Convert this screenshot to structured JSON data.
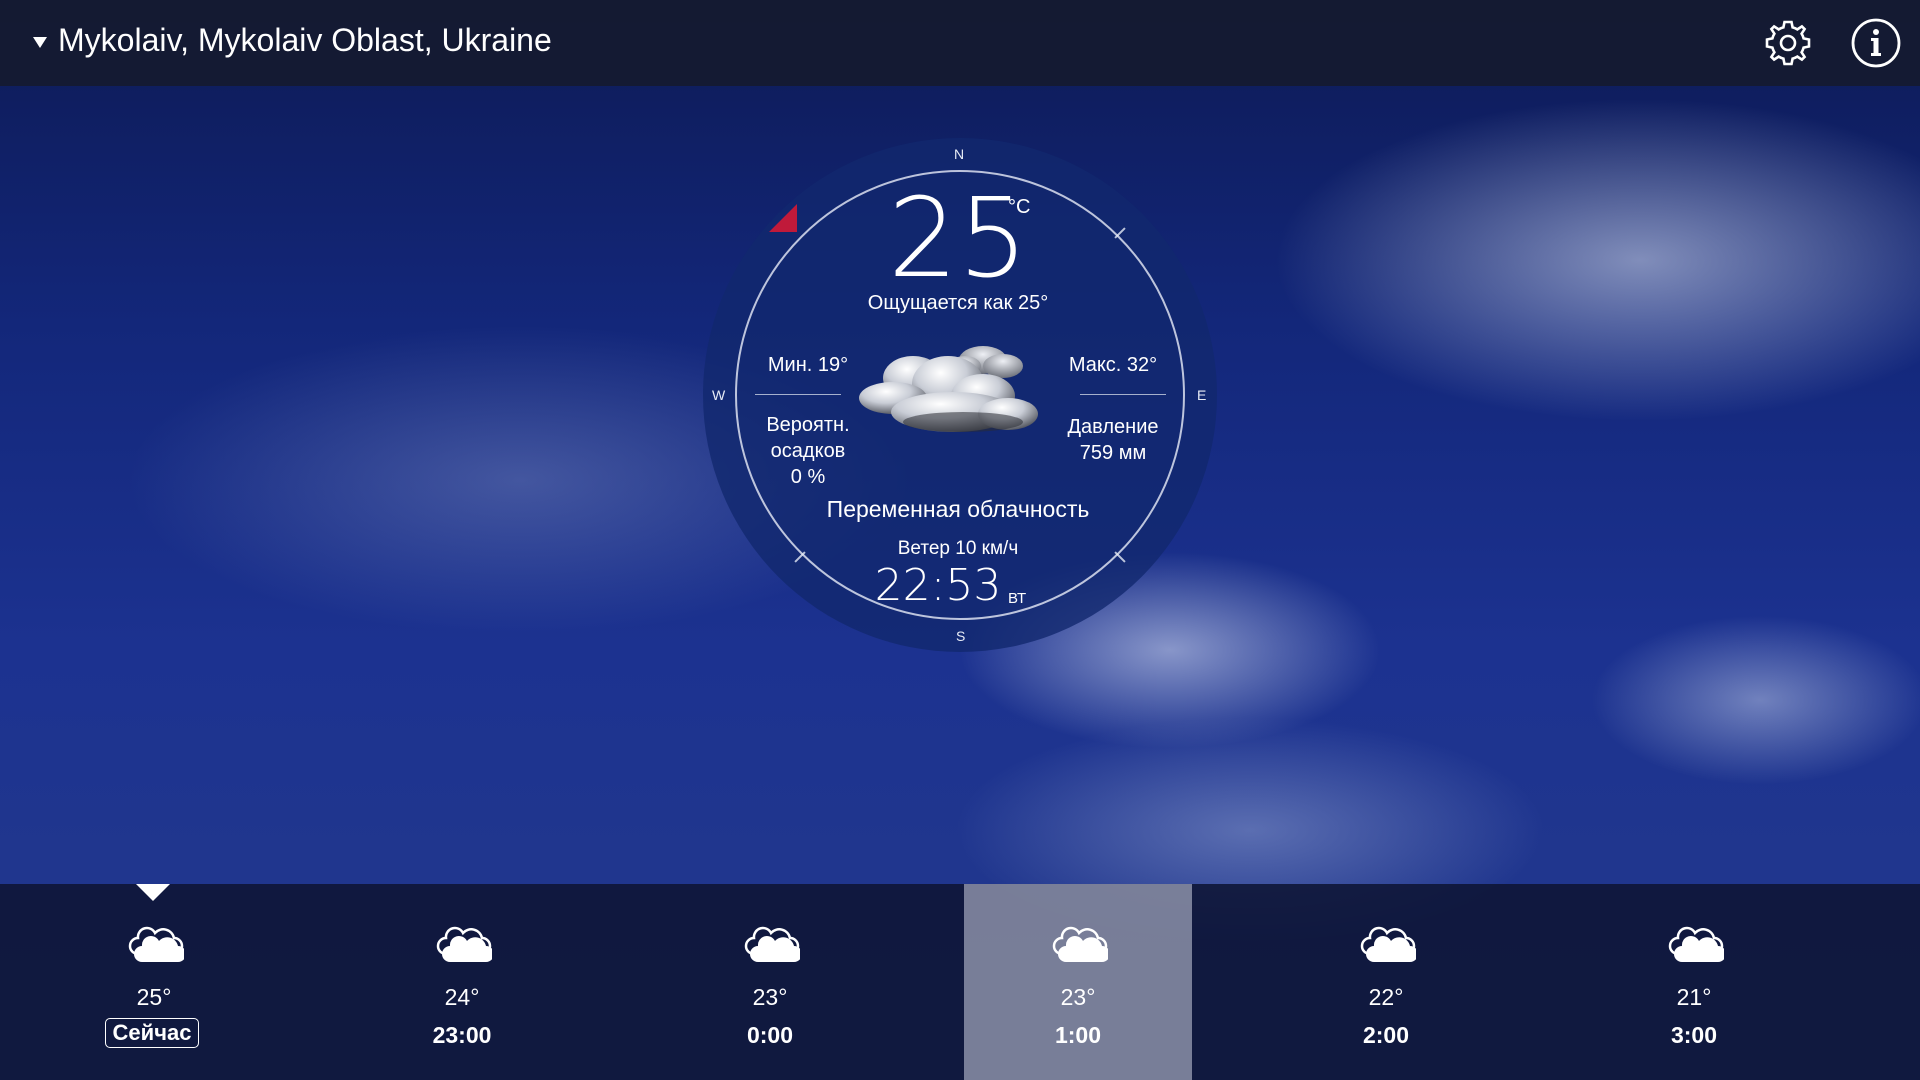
{
  "header": {
    "location": "Mykolaiv, Mykolaiv Oblast, Ukraine",
    "settings_icon": "gear-icon",
    "info_icon": "info-icon"
  },
  "current": {
    "temperature": "25",
    "unit": "°C",
    "feels_like": "Ощущается как 25°",
    "min": "Мин. 19°",
    "max": "Макс. 32°",
    "precip_label": "Вероятн. осадков",
    "precip_value": "0 %",
    "pressure_label": "Давление",
    "pressure_value": "759 мм",
    "condition": "Переменная облачность",
    "wind": "Ветер 10 км/ч",
    "time": "22:53",
    "day": "ВТ",
    "compass": {
      "n": "N",
      "e": "E",
      "s": "S",
      "w": "W"
    },
    "weather_icon": "partly-cloudy-night-icon"
  },
  "forecast": {
    "items": [
      {
        "temp": "25°",
        "label": "Сейчас",
        "icon": "cloud-icon",
        "is_now": true
      },
      {
        "temp": "24°",
        "label": "23:00",
        "icon": "cloud-icon"
      },
      {
        "temp": "23°",
        "label": "0:00",
        "icon": "cloud-icon"
      },
      {
        "temp": "23°",
        "label": "1:00",
        "icon": "cloud-icon",
        "selected": true
      },
      {
        "temp": "22°",
        "label": "2:00",
        "icon": "cloud-icon"
      },
      {
        "temp": "21°",
        "label": "3:00",
        "icon": "cloud-icon"
      }
    ]
  },
  "colors": {
    "wind_marker": "#c01a3a",
    "sky_top": "#0d1a55",
    "selected_highlight": "#cdd2e1"
  }
}
